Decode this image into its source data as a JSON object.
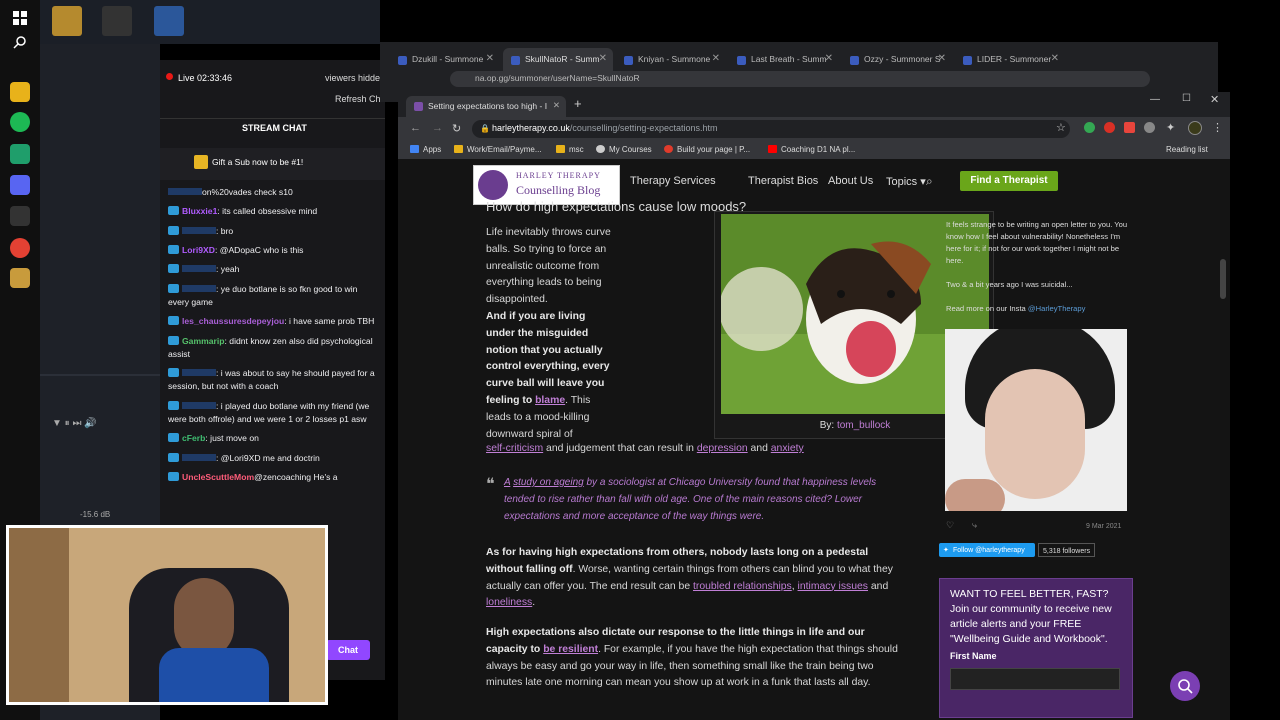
{
  "stream": {
    "live_label": "Live",
    "live_time": "02:33:46",
    "viewers_label": "viewers hidde",
    "refresh_label": "Refresh Ch",
    "chat_title": "STREAM CHAT",
    "sub_banner": "Gift a Sub now to be #1!",
    "audio_level": "-15.6 dB",
    "chat_button": "Chat",
    "chat_lines": [
      {
        "user": "",
        "text": "on%20vades check s10",
        "color": "#9147ff"
      },
      {
        "user": "Bluxxie1",
        "text": ": its called obsessive mind",
        "color": "#b05cff"
      },
      {
        "user": "",
        "text": ": bro",
        "color": "#2f9bd8"
      },
      {
        "user": "Lori9XD",
        "text": ": @ADopaC who is this",
        "color": "#b05cff"
      },
      {
        "user": "",
        "text": ": yeah",
        "color": "#2f9bd8"
      },
      {
        "user": "",
        "text": ": ye duo botlane is so fkn good to win every game",
        "color": "#2f9bd8"
      },
      {
        "user": "les_chaussuresdepeyjou",
        "text": ": i have same prob TBH",
        "color": "#a95fd6"
      },
      {
        "user": "Gammarip",
        "text": ": didnt know zen also did psychological assist",
        "color": "#56c16b"
      },
      {
        "user": "",
        "text": ": i was about to say he should payed for a session, but not with a coach",
        "color": "#2f9bd8"
      },
      {
        "user": "",
        "text": ": i played duo botlane with my friend (we were both offrole) and we were 1 or 2 losses p1 asw",
        "color": "#2f9bd8"
      },
      {
        "user": "cFerb",
        "text": ": just move on",
        "color": "#3fbf72"
      },
      {
        "user": "",
        "text": ": @Lori9XD me and doctrin",
        "color": "#2f9bd8"
      },
      {
        "user": "UncleScuttleMom",
        "text": "@zencoaching He's a",
        "color": "#ff5c7a"
      }
    ]
  },
  "back_browser": {
    "tabs": [
      "Dzukill - Summone",
      "SkullNatoR - Summ",
      "Kniyan - Summone",
      "Last Breath - Summ",
      "Ozzy - Summoner S",
      "LIDER - Summoner"
    ],
    "url": "na.op.gg/summoner/userName=SkullNatoR"
  },
  "front_browser": {
    "tab_title": "Setting expectations too high - I",
    "url_host": "harleytherapy.co.uk",
    "url_path": "/counselling/setting-expectations.htm",
    "bookmarks": [
      "Apps",
      "Work/Email/Payme...",
      "msc",
      "My Courses",
      "Build your page | P...",
      "Coaching D1 NA pl..."
    ],
    "reading_list": "Reading list"
  },
  "site": {
    "logo_line1": "HARLEY THERAPY",
    "logo_line2": "Counselling Blog",
    "nav": [
      "Therapy Services",
      "Therapist Bios",
      "About Us",
      "Topics"
    ],
    "cta": "Find a Therapist"
  },
  "article": {
    "heading": "How do high expectations cause low moods?",
    "p1": "Life inevitably throws curve balls. So trying to force an unrealistic outcome from everything leads to being disappointed.",
    "p2_bold": "And if you are living under the misguided notion that you actually control everything, every curve ball will leave you feeling to",
    "p2_link": "blame",
    "p2_rest": ". This leads to a mood-killing downward spiral of",
    "link_self_criticism": "self-criticism",
    "and_judgement": "and judgement that can result in",
    "link_depression": "depression",
    "and_word": "and",
    "link_anxiety": "anxiety",
    "photo_credit_prefix": "By:",
    "photo_credit": "tom_bullock",
    "quote_link1": "A",
    "quote_link2": "study on ageing",
    "quote_text": "by a sociologist at Chicago University found that happiness levels tended to rise rather than fall with old age. One of the main reasons cited? Lower expectations and more acceptance of the way things were.",
    "p3_bold": "As for having high expectations from others, nobody lasts long on a pedestal without falling off",
    "p3_rest": ". Worse, wanting certain things from others can blind you to what they actually can offer you. The end result can be",
    "link_troubled": "troubled relationships",
    "link_intimacy": "intimacy issues",
    "link_loneliness": "loneliness",
    "p4_bold": "High expectations also dictate our response to the little things in life and our capacity to",
    "link_resilient": "be resilient",
    "p4_rest": ". For example, if you have the high expectation that things should always be easy and go your way in life, then something small like the train being two minutes late one morning can mean you show up at work in a funk that lasts all day."
  },
  "sidebar": {
    "insta_text1": "It feels strange to be writing an open letter to you. You know how I feel about vulnerability! Nonetheless I'm here for it; if not for our work together I might not be here.",
    "insta_text2": "Two & a bit years ago I was suicidal...",
    "insta_text3": "Read more on our Insta",
    "insta_handle": "@HarleyTherapy",
    "post_date": "9 Mar 2021",
    "follow_label": "Follow @harleytherapy",
    "followers": "5,318 followers",
    "signup_title": "WANT TO FEEL BETTER, FAST?",
    "signup_text": "Join our community to receive new article alerts and your FREE \"Wellbeing Guide and Workbook\".",
    "first_name_label": "First Name"
  }
}
